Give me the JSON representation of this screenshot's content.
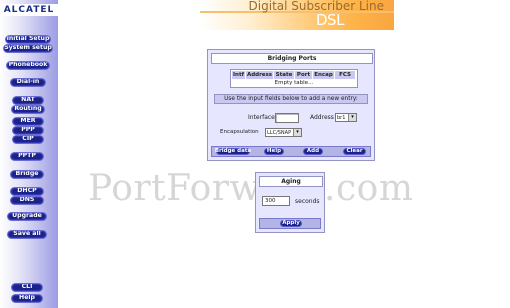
{
  "brand": {
    "logo_text": "ALCATEL"
  },
  "banner": {
    "title": "Digital Subscriber Line",
    "subtitle": "DSL"
  },
  "nav": {
    "items": [
      "Initial Setup",
      "System setup",
      "Phonebook",
      "Dial-in",
      "NAT",
      "Routing",
      "MER",
      "PPP",
      "CIP",
      "PPTP",
      "Bridge",
      "DHCP",
      "DNS",
      "Upgrade",
      "Save all",
      "CLI",
      "Help"
    ]
  },
  "bridging": {
    "title": "Bridging Ports",
    "columns": [
      "Intf",
      "Address",
      "State",
      "Port",
      "Encap",
      "FCS"
    ],
    "empty_text": "Empty table...",
    "instruction": "Use the input fields below to add a new entry:",
    "interface_label": "Interface",
    "address_label": "Address",
    "address_value": "br1",
    "encapsulation_label": "Encapsulation",
    "encapsulation_value": "LLC/SNAP",
    "buttons": [
      "Bridge data",
      "Help",
      "Add",
      "Clear"
    ]
  },
  "ageing": {
    "title": "Aging",
    "value": "300",
    "unit": "seconds",
    "apply_label": "Apply"
  },
  "watermark": {
    "text": "PortForward.com"
  },
  "colors": {
    "nav_button": "#1b2388",
    "panel_bg": "#e6e6ff",
    "header_row": "#c8c8f0",
    "banner_accent": "#ffb347"
  }
}
